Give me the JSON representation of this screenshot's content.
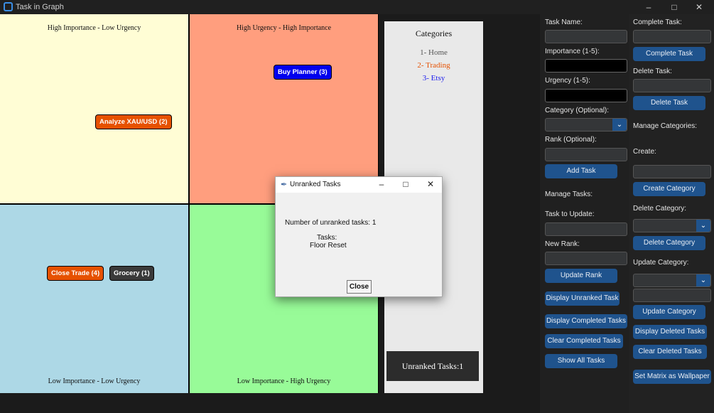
{
  "window": {
    "title": "Task in Graph"
  },
  "matrix": {
    "q_top_left": {
      "label": "High Importance - Low Urgency",
      "color": "#fffdd5"
    },
    "q_top_right": {
      "label": "High Urgency - High Importance",
      "color": "#ff9e7e"
    },
    "q_bottom_left": {
      "label": "Low Importance - Low Urgency",
      "color": "#add8e6"
    },
    "q_bottom_right": {
      "label": "Low Importance - High Urgency",
      "color": "#98fb98"
    },
    "tasks": [
      {
        "label": "Buy Planner (3)",
        "color": "#0000ee"
      },
      {
        "label": "Analyze XAU/USD (2)",
        "color": "#e65100"
      },
      {
        "label": "Close Trade (4)",
        "color": "#e65100"
      },
      {
        "label": "Grocery (1)",
        "color": "#3a3a3a"
      }
    ]
  },
  "categories_panel": {
    "heading": "Categories",
    "items": [
      {
        "label": "1- Home",
        "color": "#555555"
      },
      {
        "label": "2- Trading",
        "color": "#e65100"
      },
      {
        "label": "3- Etsy",
        "color": "#1a1aee"
      }
    ],
    "unranked_label": "Unranked Tasks:1"
  },
  "left_form": {
    "task_name_label": "Task Name:",
    "importance_label": "Importance (1-5):",
    "urgency_label": "Urgency (1-5):",
    "category_label": "Category (Optional):",
    "rank_label": "Rank (Optional):",
    "add_task_btn": "Add Task",
    "manage_tasks_label": "Manage Tasks:",
    "task_to_update_label": "Task to Update:",
    "new_rank_label": "New Rank:",
    "update_rank_btn": "Update Rank",
    "display_unranked_btn": "Display Unranked Task",
    "display_completed_btn": "Display Completed Tasks",
    "clear_completed_btn": "Clear Completed Tasks",
    "show_all_btn": "Show All Tasks"
  },
  "right_form": {
    "complete_task_label": "Complete Task:",
    "complete_task_btn": "Complete Task",
    "delete_task_label": "Delete Task:",
    "delete_task_btn": "Delete Task",
    "manage_categories_label": "Manage Categories:",
    "create_label": "Create:",
    "create_category_btn": "Create Category",
    "delete_category_label": "Delete Category:",
    "delete_category_btn": "Delete Category",
    "update_category_label": "Update Category:",
    "update_category_btn": "Update Category",
    "display_deleted_btn": "Display Deleted Tasks",
    "clear_deleted_btn": "Clear Deleted Tasks",
    "set_wallpaper_btn": "Set Matrix as Wallpaper"
  },
  "dialog": {
    "title": "Unranked Tasks",
    "count_text": "Number of unranked tasks: 1",
    "tasks_heading": "Tasks:",
    "task_item": "Floor Reset",
    "close_btn": "Close"
  },
  "icons": {
    "minimize": "minimize-icon",
    "maximize": "maximize-icon",
    "close": "close-icon",
    "chevron": "chevron-down-icon",
    "feather": "feather-icon"
  }
}
